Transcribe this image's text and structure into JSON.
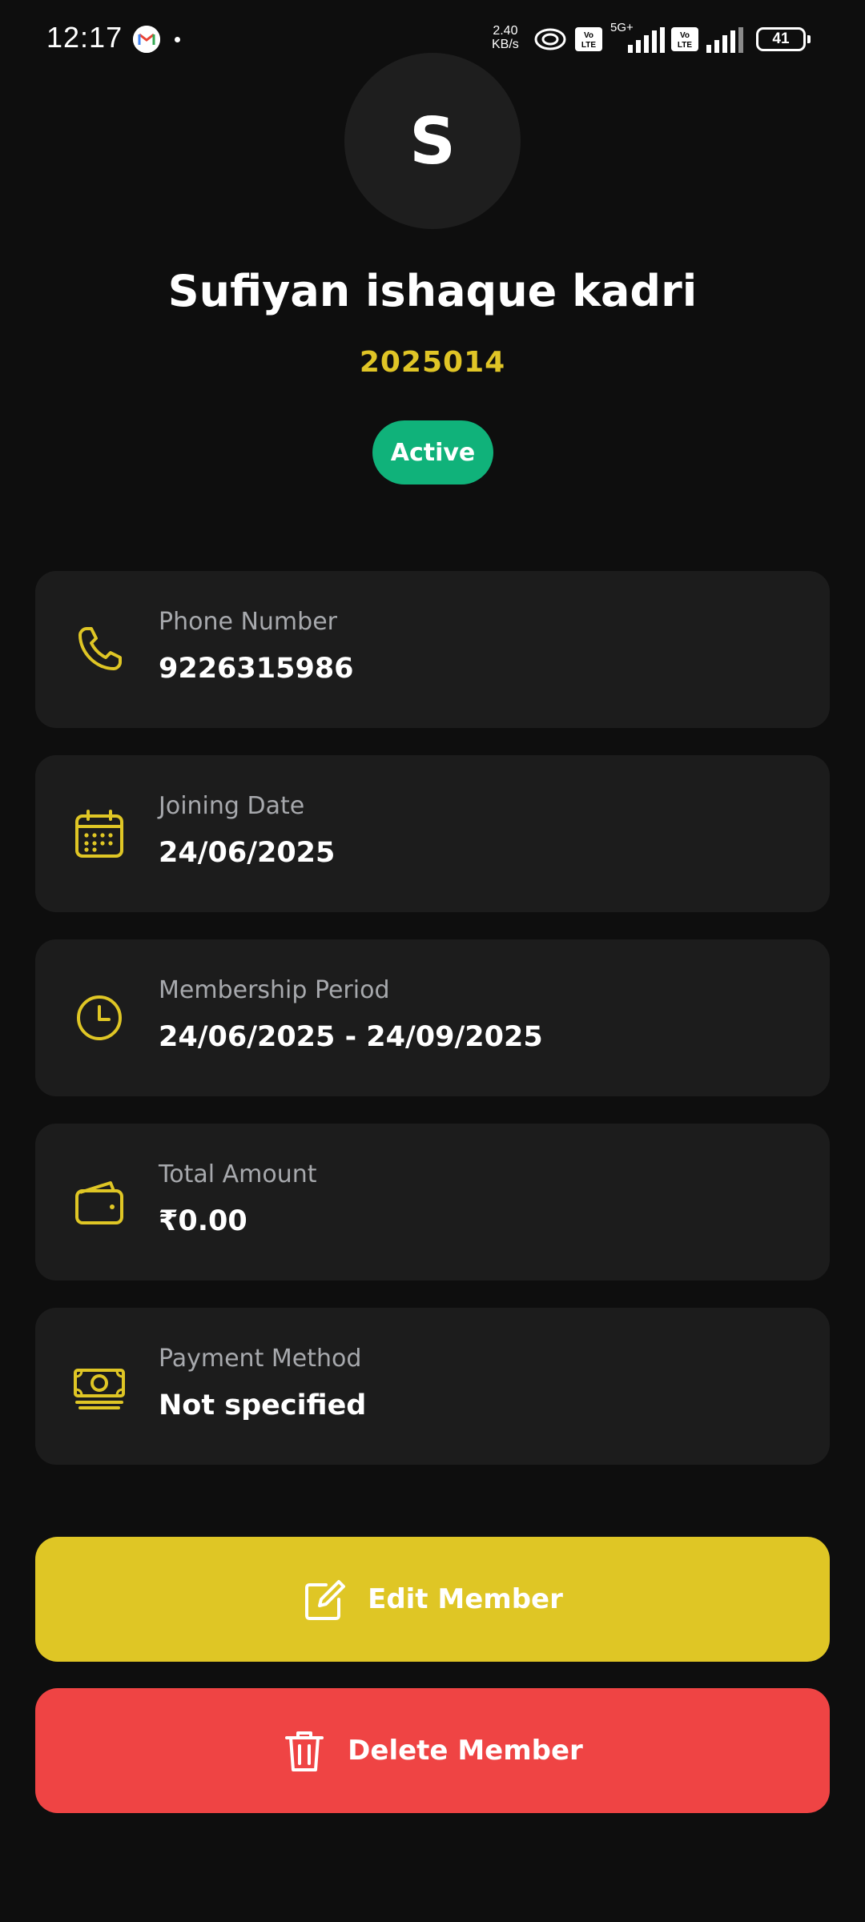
{
  "status_bar": {
    "time": "12:17",
    "network_speed": "2.40\nKB/s",
    "network_speed_line1": "2.40",
    "network_speed_line2": "KB/s",
    "network_type": "5G+",
    "battery": "41",
    "icons": [
      "gmail-icon",
      "notification-dot-icon",
      "hotspot-icon",
      "volte-icon",
      "signal-icon",
      "volte-icon",
      "signal-icon",
      "battery-icon"
    ]
  },
  "profile": {
    "avatar_initial": "S",
    "name": "Sufiyan ishaque kadri",
    "member_id": "2025014",
    "status": "Active"
  },
  "details": [
    {
      "icon": "phone-icon",
      "label": "Phone Number",
      "value": "9226315986"
    },
    {
      "icon": "calendar-icon",
      "label": "Joining Date",
      "value": "24/06/2025"
    },
    {
      "icon": "clock-icon",
      "label": "Membership Period",
      "value": "24/06/2025 - 24/09/2025"
    },
    {
      "icon": "wallet-icon",
      "label": "Total Amount",
      "value": "₹0.00"
    },
    {
      "icon": "cash-icon",
      "label": "Payment Method",
      "value": "Not specified"
    }
  ],
  "actions": {
    "edit_label": "Edit Member",
    "delete_label": "Delete Member"
  },
  "colors": {
    "background": "#0e0e0e",
    "card": "#1c1c1c",
    "accent_yellow": "#dfc625",
    "active_green": "#10b27a",
    "danger_red": "#ef4444",
    "label_gray": "#a7a9ad"
  }
}
